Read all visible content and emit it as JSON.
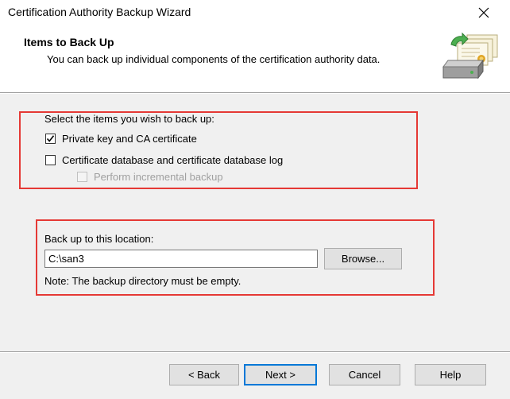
{
  "window": {
    "title": "Certification Authority Backup Wizard"
  },
  "header": {
    "title": "Items to Back Up",
    "subtitle": "You can back up individual components of the certification authority data.",
    "icon": "backup-wizard-icon"
  },
  "items": {
    "prompt": "Select the items you wish to back up:",
    "private_key": {
      "label": "Private key and CA certificate",
      "checked": true
    },
    "cert_db": {
      "label": "Certificate database and certificate database log",
      "checked": false
    },
    "incremental": {
      "label": "Perform incremental backup",
      "checked": false,
      "enabled": false
    }
  },
  "location": {
    "label": "Back up to this location:",
    "value": "C:\\san3",
    "browse_label": "Browse...",
    "note": "Note: The backup directory must be empty."
  },
  "buttons": {
    "back": "< Back",
    "next": "Next >",
    "cancel": "Cancel",
    "help": "Help"
  },
  "colors": {
    "highlight_box": "#e53935",
    "default_button_border": "#0078d7"
  }
}
